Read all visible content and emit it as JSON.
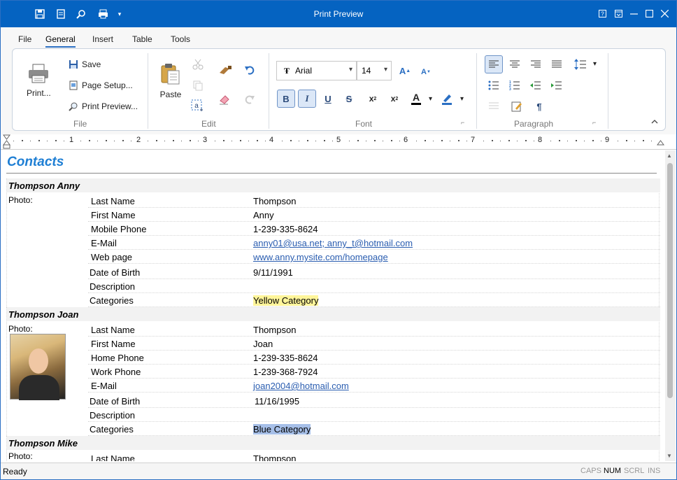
{
  "window": {
    "title": "Print Preview"
  },
  "quick_access": [
    "save-icon",
    "document-icon",
    "preview-icon",
    "print-icon",
    "customize-icon"
  ],
  "tabs": [
    {
      "label": "File"
    },
    {
      "label": "General",
      "active": true
    },
    {
      "label": "Insert"
    },
    {
      "label": "Table"
    },
    {
      "label": "Tools"
    }
  ],
  "ribbon": {
    "file": {
      "print_label": "Print...",
      "save_label": "Save",
      "page_setup_label": "Page Setup...",
      "print_preview_label": "Print Preview...",
      "group_label": "File"
    },
    "edit": {
      "paste_label": "Paste",
      "group_label": "Edit"
    },
    "font": {
      "family": "Arial",
      "size": "14",
      "group_label": "Font"
    },
    "paragraph": {
      "group_label": "Paragraph"
    }
  },
  "ruler": {
    "numbers": [
      "1",
      "2",
      "3",
      "4",
      "5",
      "6",
      "7",
      "8",
      "9"
    ]
  },
  "document": {
    "title": "Contacts",
    "photo_label": "Photo:",
    "contacts": [
      {
        "name": "Thompson Anny",
        "rows": [
          {
            "k": "Last Name",
            "v": "Thompson"
          },
          {
            "k": "First Name",
            "v": "Anny"
          },
          {
            "k": "Mobile Phone",
            "v": "1-239-335-8624"
          },
          {
            "k": "E-Mail",
            "v": "anny01@usa.net; anny_t@hotmail.com",
            "link": true
          },
          {
            "k": "Web page",
            "v": "www.anny.mysite.com/homepage",
            "link": true
          },
          {
            "k": "Date of Birth",
            "v": "9/11/1991"
          },
          {
            "k": "Description",
            "v": ""
          },
          {
            "k": "Categories",
            "v": "Yellow Category",
            "cat": "yellow"
          }
        ]
      },
      {
        "name": "Thompson Joan",
        "rows": [
          {
            "k": "Last Name",
            "v": "Thompson"
          },
          {
            "k": "First Name",
            "v": "Joan"
          },
          {
            "k": "Home Phone",
            "v": "1-239-335-8624"
          },
          {
            "k": "Work Phone",
            "v": "1-239-368-7924"
          },
          {
            "k": "E-Mail",
            "v": "joan2004@hotmail.com",
            "link": true
          },
          {
            "k": "Date of Birth",
            "v": "11/16/1995"
          },
          {
            "k": "Description",
            "v": ""
          },
          {
            "k": "Categories",
            "v": "Blue Category",
            "cat": "blue"
          }
        ]
      },
      {
        "name": "Thompson Mike",
        "rows": [
          {
            "k": "Last Name",
            "v": "Thompson"
          }
        ]
      }
    ]
  },
  "status": {
    "ready": "Ready",
    "indicators": [
      {
        "label": "CAPS",
        "on": false
      },
      {
        "label": "NUM",
        "on": true
      },
      {
        "label": "SCRL",
        "on": false
      },
      {
        "label": "INS",
        "on": false
      }
    ]
  }
}
